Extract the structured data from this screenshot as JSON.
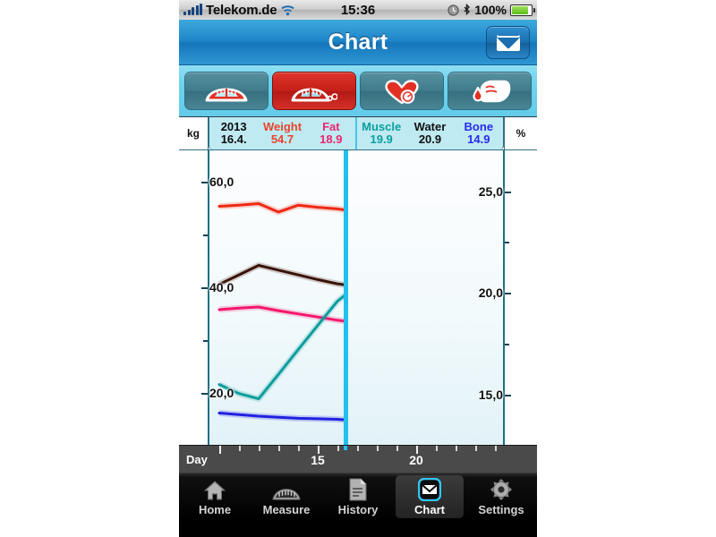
{
  "statusbar": {
    "signal_icon": "signal-bars-icon",
    "carrier": "Telekom.de",
    "wifi_icon": "wifi-icon",
    "time": "15:36",
    "alarm_icon": "clock-icon",
    "bluetooth_icon": "bluetooth-icon",
    "battery_percent": "100%",
    "battery_icon": "battery-icon"
  },
  "navbar": {
    "title": "Chart",
    "mail_button_icon": "envelope-icon"
  },
  "modebar": {
    "buttons": [
      {
        "name": "scale-button",
        "icon": "scale-icon",
        "selected": false
      },
      {
        "name": "body-composition-button",
        "icon": "scale-bubbles-icon",
        "selected": true
      },
      {
        "name": "blood-pressure-button",
        "icon": "heart-gauge-icon",
        "selected": false
      },
      {
        "name": "glucose-button",
        "icon": "finger-blood-drop-icon",
        "selected": false
      }
    ]
  },
  "chart_header": {
    "left_unit": "kg",
    "right_unit": "%",
    "columns": [
      {
        "title": "2013",
        "value": "16.4.",
        "color": "#0b0b0b"
      },
      {
        "title": "Weight",
        "value": "54.7",
        "color": "#e8442a"
      },
      {
        "title": "Fat",
        "value": "18.9",
        "color": "#f0246e"
      },
      {
        "title": "Muscle",
        "value": "19.9",
        "color": "#0a9e9e"
      },
      {
        "title": "Water",
        "value": "20.9",
        "color": "#111111"
      },
      {
        "title": "Bone",
        "value": "14.9",
        "color": "#2a2aee"
      }
    ]
  },
  "chart_data": {
    "type": "line",
    "title": "Chart",
    "xlabel": "Day",
    "ylabel": "kg",
    "y2label": "%",
    "grid": false,
    "legend": "top",
    "xlim": [
      9.5,
      24.5
    ],
    "xticks": [
      10,
      11,
      12,
      13,
      14,
      15,
      16,
      17,
      18,
      19,
      20,
      21,
      22,
      23,
      24
    ],
    "xtick_labels": [
      {
        "x": 15,
        "label": "15"
      },
      {
        "x": 20,
        "label": "20"
      }
    ],
    "ylim_left": [
      10.0,
      66.0
    ],
    "yticks_left": [
      20.0,
      30.0,
      40.0,
      50.0,
      60.0
    ],
    "ytick_labels_left": [
      "20,0",
      "40,0",
      "60,0"
    ],
    "ylim_right": [
      12.5,
      27.0
    ],
    "yticks_right": [
      15.0,
      17.5,
      20.0,
      22.5,
      25.0
    ],
    "ytick_labels_right": [
      "15,0",
      "20,0",
      "25,0"
    ],
    "cursor_x": 16.4,
    "cursor_color": "#22c0ef",
    "series": [
      {
        "name": "Weight",
        "axis": "left",
        "unit": "kg",
        "color": "#ee2a12",
        "x": [
          10,
          11,
          12,
          13,
          14,
          15,
          16,
          16.4
        ],
        "values": [
          55.4,
          55.6,
          55.9,
          54.3,
          55.6,
          55.2,
          54.9,
          54.7
        ]
      },
      {
        "name": "Water",
        "axis": "left",
        "unit": "kg",
        "color": "#3a1408",
        "x": [
          10,
          11,
          12,
          13,
          14,
          15,
          16,
          16.4
        ],
        "values": [
          40.6,
          42.4,
          44.2,
          43.3,
          42.4,
          41.5,
          40.7,
          40.5
        ]
      },
      {
        "name": "Fat",
        "axis": "left",
        "unit": "kg",
        "color": "#f5186d",
        "x": [
          10,
          11,
          12,
          13,
          14,
          15,
          16,
          16.4
        ],
        "values": [
          35.8,
          36.1,
          36.3,
          35.6,
          35.0,
          34.4,
          33.8,
          33.6
        ]
      },
      {
        "name": "Muscle",
        "axis": "left",
        "unit": "kg",
        "color": "#0d9d9d",
        "x": [
          10,
          11,
          12,
          13,
          14,
          15,
          16,
          16.4
        ],
        "values": [
          21.6,
          19.9,
          18.9,
          23.5,
          28.2,
          32.8,
          37.4,
          38.6
        ]
      },
      {
        "name": "Bone",
        "axis": "left",
        "unit": "kg",
        "color": "#2121e0",
        "x": [
          10,
          11,
          12,
          13,
          14,
          15,
          16,
          16.4
        ],
        "values": [
          16.2,
          15.9,
          15.6,
          15.4,
          15.2,
          15.1,
          15.0,
          14.9
        ]
      }
    ]
  },
  "xaxis": {
    "day_label": "Day",
    "labels": [
      {
        "x": 15,
        "text": "15"
      },
      {
        "x": 20,
        "text": "20"
      }
    ]
  },
  "tabbar": {
    "tabs": [
      {
        "label": "Home",
        "icon": "house-icon",
        "selected": false
      },
      {
        "label": "Measure",
        "icon": "scale-icon",
        "selected": false
      },
      {
        "label": "History",
        "icon": "document-icon",
        "selected": false
      },
      {
        "label": "Chart",
        "icon": "envelope-icon",
        "selected": true
      },
      {
        "label": "Settings",
        "icon": "gear-icon",
        "selected": false
      }
    ]
  }
}
